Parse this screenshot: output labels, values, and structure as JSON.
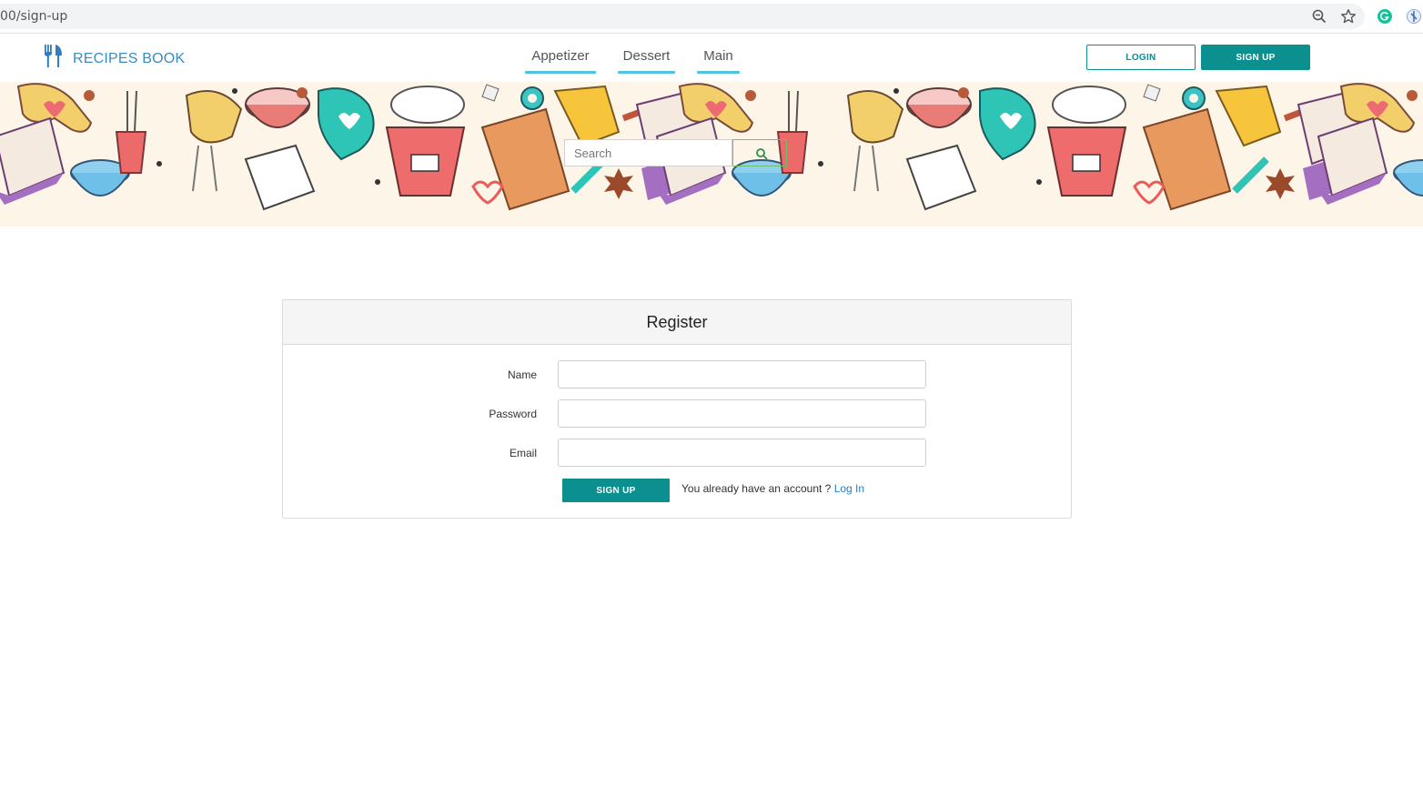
{
  "browser": {
    "url": "00/sign-up",
    "icons": [
      "zoom-icon",
      "star-icon",
      "grammarly-icon",
      "extension-icon"
    ]
  },
  "brand": {
    "name": "RECIPES BOOK",
    "icon": "fork-knife-icon",
    "color": "#3b8cc4"
  },
  "nav": {
    "tabs": [
      {
        "label": "Appetizer"
      },
      {
        "label": "Dessert"
      },
      {
        "label": "Main"
      }
    ],
    "underline_color": "#4ec3e0"
  },
  "auth": {
    "login_label": "LOGIN",
    "signup_label": "SIGN UP",
    "accent_color": "#0b8f8f"
  },
  "search": {
    "placeholder": "Search",
    "icon": "search-icon"
  },
  "register": {
    "title": "Register",
    "fields": [
      {
        "label": "Name",
        "value": ""
      },
      {
        "label": "Password",
        "value": ""
      },
      {
        "label": "Email",
        "value": ""
      }
    ],
    "submit_label": "SIGN UP",
    "account_prompt": "You already have an account ?",
    "login_link": "Log In"
  }
}
